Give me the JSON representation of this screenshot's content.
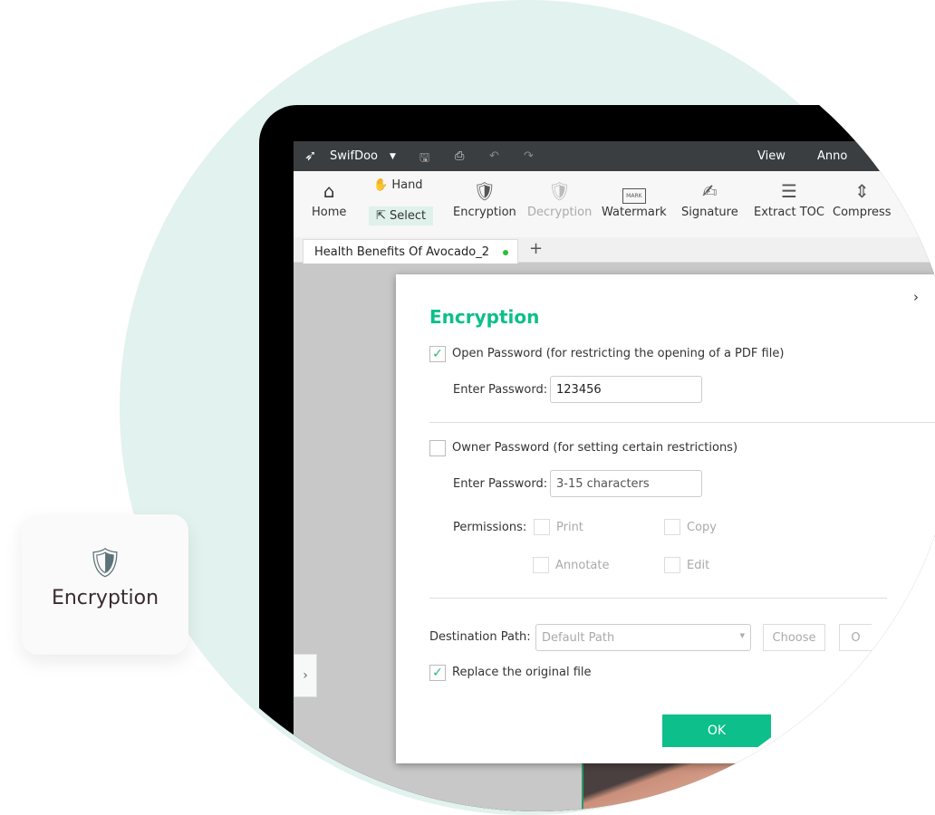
{
  "app": {
    "name": "SwifDoo",
    "menus": [
      "View",
      "Anno"
    ]
  },
  "toolbar": {
    "home": "Home",
    "hand": "Hand",
    "select": "Select",
    "encryption": "Encryption",
    "decryption": "Decryption",
    "watermark": "Watermark",
    "watermark_mark": "MARK",
    "signature": "Signature",
    "extract_toc": "Extract TOC",
    "compress": "Compress"
  },
  "tab": {
    "title": "Health Benefits Of Avocado_2",
    "add": "+"
  },
  "dialog": {
    "title": "Encryption",
    "open_password_label": "Open Password (for restricting the opening of a PDF file)",
    "open_password_checked": true,
    "enter_password_label": "Enter Password:",
    "open_password_value": "123456",
    "owner_password_label": "Owner Password (for setting certain restrictions)",
    "owner_password_checked": false,
    "owner_password_placeholder": "3-15 characters",
    "permissions_label": "Permissions:",
    "permissions": [
      "Print",
      "Copy",
      "Annotate",
      "Edit"
    ],
    "destination_label": "Destination Path:",
    "destination_value": "Default Path",
    "choose": "Choose",
    "open_partial": "O",
    "replace_label": "Replace the original file",
    "replace_checked": true,
    "ok": "OK"
  },
  "feature_card": {
    "label": "Encryption"
  },
  "colors": {
    "accent": "#0dbf8a",
    "background_circle": "#e2f2ee",
    "titlebar": "#3b3e41"
  }
}
